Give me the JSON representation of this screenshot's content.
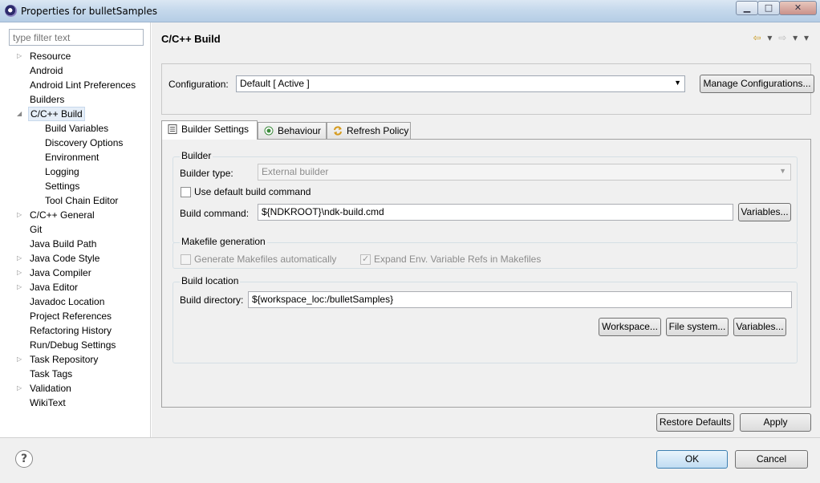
{
  "window": {
    "title": "Properties for bulletSamples",
    "minimize_label": "▁",
    "maximize_label": "□",
    "close_label": "✕"
  },
  "sidebar": {
    "filter_placeholder": "type filter text",
    "items": [
      {
        "label": "Resource",
        "expander": "▷",
        "child": false,
        "selected": false
      },
      {
        "label": "Android",
        "expander": "",
        "child": false,
        "selected": false
      },
      {
        "label": "Android Lint Preferences",
        "expander": "",
        "child": false,
        "selected": false
      },
      {
        "label": "Builders",
        "expander": "",
        "child": false,
        "selected": false
      },
      {
        "label": "C/C++ Build",
        "expander": "◢",
        "child": false,
        "selected": true
      },
      {
        "label": "Build Variables",
        "expander": "",
        "child": true,
        "selected": false
      },
      {
        "label": "Discovery Options",
        "expander": "",
        "child": true,
        "selected": false
      },
      {
        "label": "Environment",
        "expander": "",
        "child": true,
        "selected": false
      },
      {
        "label": "Logging",
        "expander": "",
        "child": true,
        "selected": false
      },
      {
        "label": "Settings",
        "expander": "",
        "child": true,
        "selected": false
      },
      {
        "label": "Tool Chain Editor",
        "expander": "",
        "child": true,
        "selected": false
      },
      {
        "label": "C/C++ General",
        "expander": "▷",
        "child": false,
        "selected": false
      },
      {
        "label": "Git",
        "expander": "",
        "child": false,
        "selected": false
      },
      {
        "label": "Java Build Path",
        "expander": "",
        "child": false,
        "selected": false
      },
      {
        "label": "Java Code Style",
        "expander": "▷",
        "child": false,
        "selected": false
      },
      {
        "label": "Java Compiler",
        "expander": "▷",
        "child": false,
        "selected": false
      },
      {
        "label": "Java Editor",
        "expander": "▷",
        "child": false,
        "selected": false
      },
      {
        "label": "Javadoc Location",
        "expander": "",
        "child": false,
        "selected": false
      },
      {
        "label": "Project References",
        "expander": "",
        "child": false,
        "selected": false
      },
      {
        "label": "Refactoring History",
        "expander": "",
        "child": false,
        "selected": false
      },
      {
        "label": "Run/Debug Settings",
        "expander": "",
        "child": false,
        "selected": false
      },
      {
        "label": "Task Repository",
        "expander": "▷",
        "child": false,
        "selected": false
      },
      {
        "label": "Task Tags",
        "expander": "",
        "child": false,
        "selected": false
      },
      {
        "label": "Validation",
        "expander": "▷",
        "child": false,
        "selected": false
      },
      {
        "label": "WikiText",
        "expander": "",
        "child": false,
        "selected": false
      }
    ]
  },
  "page": {
    "title": "C/C++ Build",
    "nav_back": "⇦",
    "nav_forward": "⇨",
    "nav_menu": "▾"
  },
  "configuration": {
    "label": "Configuration:",
    "value": "Default  [ Active ]",
    "manage_button": "Manage Configurations..."
  },
  "tabs": [
    {
      "label": "Builder Settings",
      "icon": "list-icon",
      "active": true
    },
    {
      "label": "Behaviour",
      "icon": "radio-icon",
      "active": false
    },
    {
      "label": "Refresh Policy",
      "icon": "refresh-icon",
      "active": false
    }
  ],
  "builder": {
    "group_title": "Builder",
    "type_label": "Builder type:",
    "type_value": "External builder",
    "use_default_label": "Use default build command",
    "use_default_checked": false,
    "command_label": "Build command:",
    "command_value": "${NDKROOT}\\ndk-build.cmd",
    "variables_button": "Variables..."
  },
  "makefile": {
    "group_title": "Makefile generation",
    "generate_label": "Generate Makefiles automatically",
    "generate_checked": false,
    "expand_label": "Expand Env. Variable Refs in Makefiles",
    "expand_checked": true
  },
  "location": {
    "group_title": "Build location",
    "directory_label": "Build directory:",
    "directory_value": "${workspace_loc:/bulletSamples}",
    "workspace_button": "Workspace...",
    "filesystem_button": "File system...",
    "variables_button": "Variables..."
  },
  "actions": {
    "restore_defaults": "Restore Defaults",
    "apply": "Apply",
    "ok": "OK",
    "cancel": "Cancel",
    "help_glyph": "?"
  }
}
